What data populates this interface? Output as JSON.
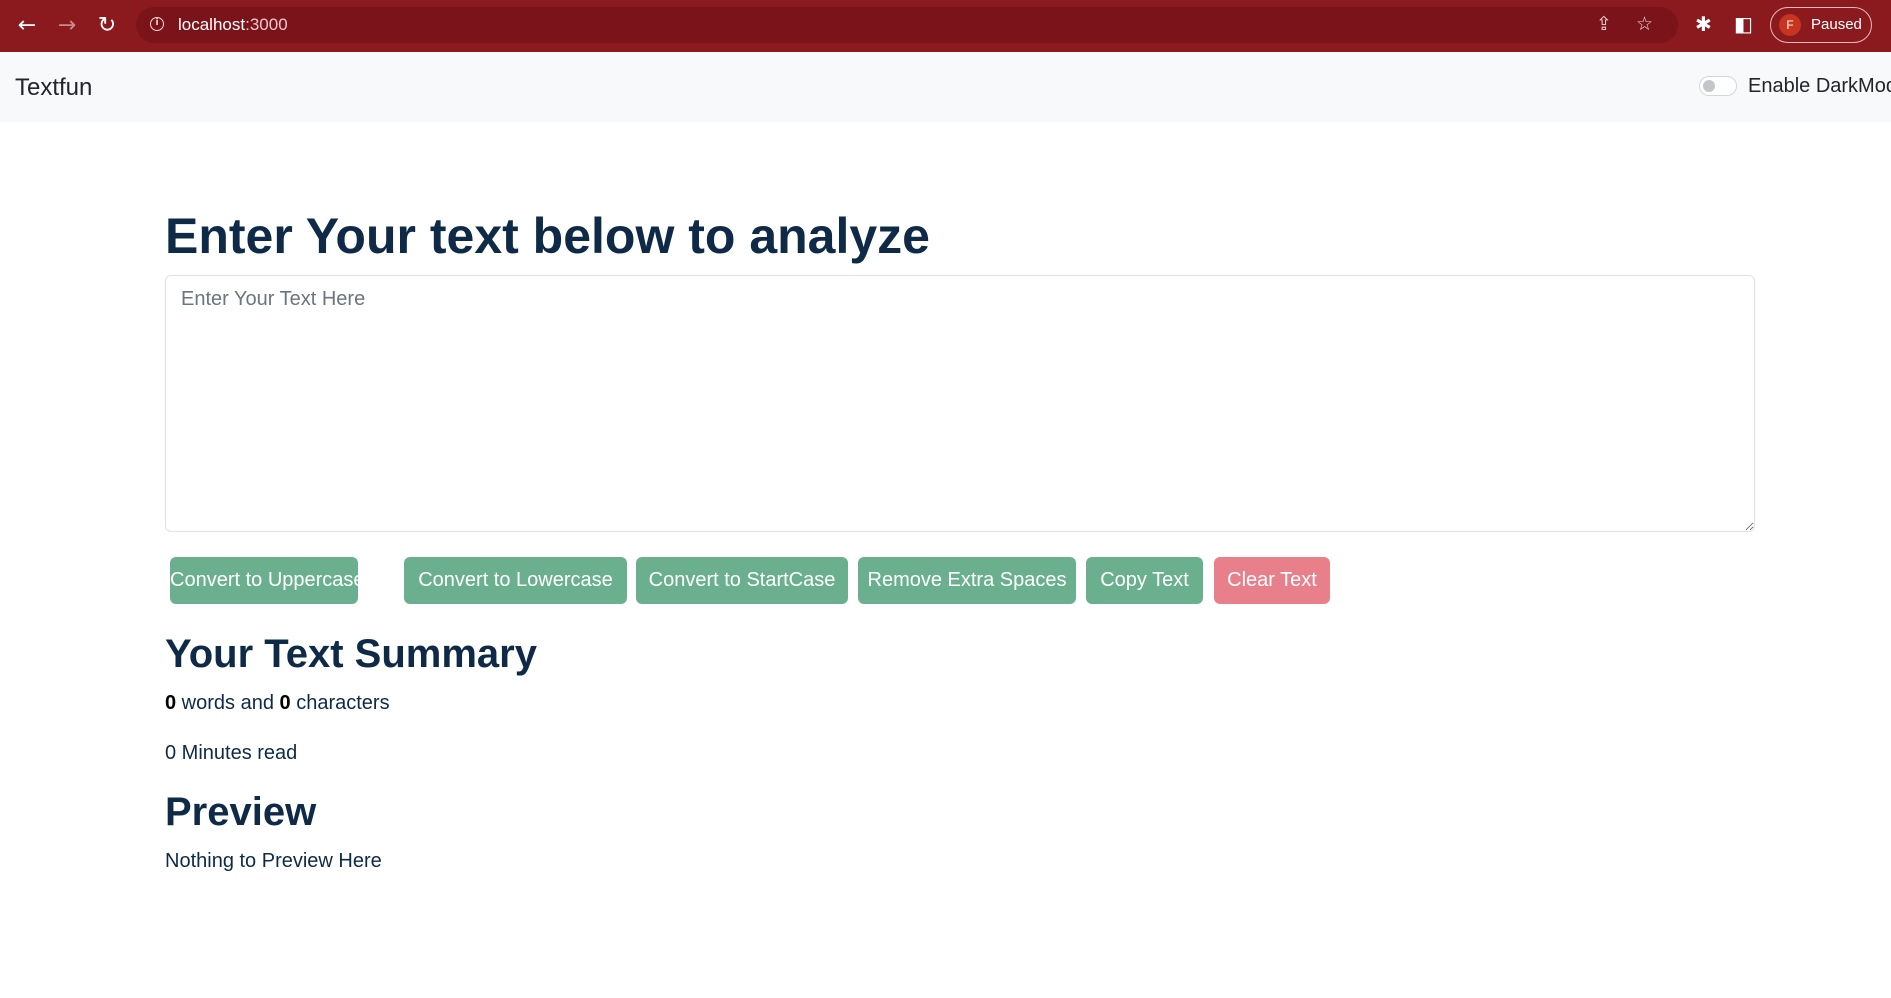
{
  "browser": {
    "url_host": "localhost",
    "url_port": ":3000",
    "profile_initial": "F",
    "profile_status": "Paused",
    "colors": {
      "frame": "#8b1a1f",
      "omnibox": "#7a141a"
    }
  },
  "navbar": {
    "brand": "Textfun",
    "darkmode_label": "Enable DarkMode",
    "darkmode_enabled": false
  },
  "main": {
    "heading": "Enter Your text below to analyze",
    "textarea_placeholder": "Enter Your Text Here",
    "textarea_value": "",
    "buttons": [
      {
        "label": "Convert to Uppercase",
        "color": "#6ab08f"
      },
      {
        "label": "Convert to Lowercase",
        "color": "#6ab08f"
      },
      {
        "label": "Convert to StartCase",
        "color": "#6ab08f"
      },
      {
        "label": "Remove Extra Spaces",
        "color": "#6ab08f"
      },
      {
        "label": "Copy Text",
        "color": "#6ab08f"
      },
      {
        "label": "Clear Text",
        "color": "#e8808c"
      }
    ]
  },
  "summary": {
    "heading": "Your Text Summary",
    "words": "0",
    "words_text": " words and ",
    "characters": "0",
    "characters_text": " characters",
    "minutes_read": "0 Minutes read"
  },
  "preview": {
    "heading": "Preview",
    "text": "Nothing to Preview Here"
  },
  "colors": {
    "text": "#0e2a47",
    "navbar_bg": "#f8f9fa"
  }
}
